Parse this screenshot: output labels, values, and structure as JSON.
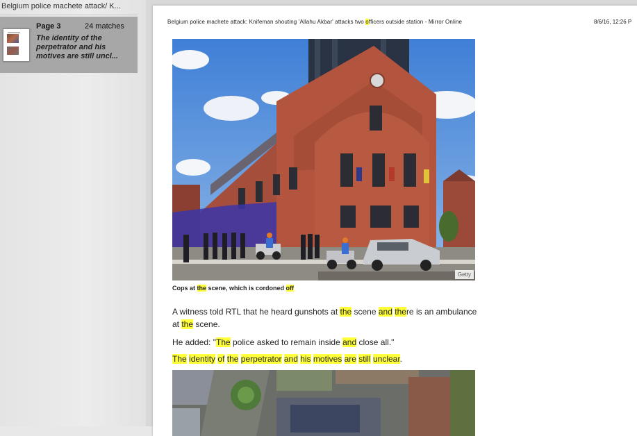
{
  "sidebar": {
    "title": "Belgium police machete attack/ K...",
    "result": {
      "page": "Page 3",
      "matches": "24 matches",
      "snippet": "The identity of the perpetrator and his motives are still uncl..."
    }
  },
  "document": {
    "header_title_parts": [
      "Belgium police machete attack: Knifeman shouting 'Allahu Akbar' attacks two ",
      "o",
      "fficers outside station - Mirror Online"
    ],
    "header_date": "8/6/16, 12:26 P",
    "photo_credit": "Getty",
    "caption_parts": [
      "Cops at ",
      "the",
      " scene, which is cordoned ",
      "off"
    ],
    "p1_parts": [
      "A witness told RTL that he heard gunshots at ",
      "the",
      " scene ",
      "and",
      " ",
      "the",
      "re is an ambulance at ",
      "the",
      " scene."
    ],
    "p2_parts": [
      "He added: \"",
      "The",
      " police asked to remain inside ",
      "and",
      " close all.\""
    ],
    "p3_parts": [
      "The",
      " ",
      "identity",
      " ",
      "of",
      " ",
      "the",
      " ",
      "perpetrator",
      " ",
      "and",
      " ",
      "his",
      " ",
      "motives",
      " ",
      "are",
      " ",
      "still",
      " ",
      "unclear",
      "."
    ]
  },
  "colors": {
    "highlight": "#ffff3a",
    "sidebar_selected": "#a7a7a7"
  }
}
